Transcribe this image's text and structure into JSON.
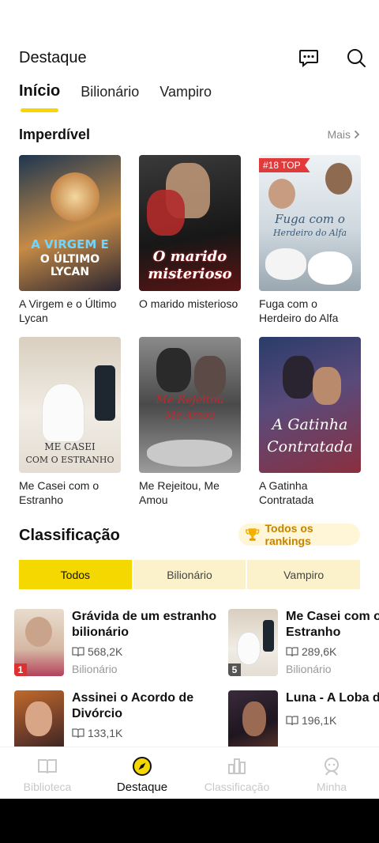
{
  "header": {
    "title": "Destaque"
  },
  "tabs": [
    {
      "label": "Início",
      "active": true
    },
    {
      "label": "Bilionário",
      "active": false
    },
    {
      "label": "Vampiro",
      "active": false
    }
  ],
  "featured": {
    "title": "Imperdível",
    "more": "Mais",
    "books": [
      {
        "title": "A Virgem e o Último Lycan",
        "cover_text": [
          "A VIRGEM E",
          "O ÚLTIMO LYCAN"
        ],
        "colors": [
          "#26415a",
          "#b3753b"
        ]
      },
      {
        "title": "O marido misterioso",
        "cover_text": [
          "O marido",
          "misterioso"
        ],
        "colors": [
          "#2a2a2a",
          "#b0322a"
        ]
      },
      {
        "title": "Fuga com o Herdeiro do Alfa",
        "cover_text": [
          "Fuga com o",
          "Herdeiro do Alfa"
        ],
        "badge": "#18 TOP",
        "colors": [
          "#d9e1e8",
          "#8a9aa6"
        ]
      },
      {
        "title": "Me Casei com o Estranho",
        "cover_text": [
          "ME CASEI",
          "COM O ESTRANHO"
        ],
        "colors": [
          "#e9e3d8",
          "#a77b5a"
        ]
      },
      {
        "title": "Me Rejeitou, Me Amou",
        "cover_text": [
          "Me Rejeitou",
          "Me Amou"
        ],
        "colors": [
          "#6c6c6c",
          "#2d2d2d"
        ]
      },
      {
        "title": "A Gatinha Contratada",
        "cover_text": [
          "A Gatinha",
          "Contratada"
        ],
        "colors": [
          "#2b3e6c",
          "#c24b4b"
        ]
      }
    ]
  },
  "ranking": {
    "title": "Classificação",
    "all_rankings": "Todos os rankings",
    "segments": [
      {
        "label": "Todos",
        "active": true
      },
      {
        "label": "Bilionário",
        "active": false
      },
      {
        "label": "Vampiro",
        "active": false
      }
    ],
    "items": [
      {
        "rank": "1",
        "title": "Grávida de um estranho bilionário",
        "reads": "568,2K",
        "genre": "Bilionário",
        "colors": [
          "#e7d7c8",
          "#b24a5a"
        ]
      },
      {
        "rank": "5",
        "title": "Me Casei com o Estranho",
        "reads": "289,6K",
        "genre": "Bilionário",
        "colors": [
          "#e9e3d8",
          "#a77b5a"
        ]
      },
      {
        "rank": "",
        "title": "Assinei o Acordo de Divórcio",
        "reads": "133,1K",
        "genre": "",
        "colors": [
          "#b35a2a",
          "#3a2a2a"
        ]
      },
      {
        "rank": "",
        "title": "Luna - A Loba da",
        "reads": "196,1K",
        "genre": "",
        "colors": [
          "#2a1e2e",
          "#7a4a3a"
        ]
      }
    ]
  },
  "nav": [
    {
      "label": "Biblioteca",
      "icon": "book-icon",
      "active": false
    },
    {
      "label": "Destaque",
      "icon": "compass-icon",
      "active": true
    },
    {
      "label": "Classificação",
      "icon": "bar-chart-icon",
      "active": false
    },
    {
      "label": "Minha",
      "icon": "user-icon",
      "active": false
    }
  ],
  "accent": "#f4d800"
}
